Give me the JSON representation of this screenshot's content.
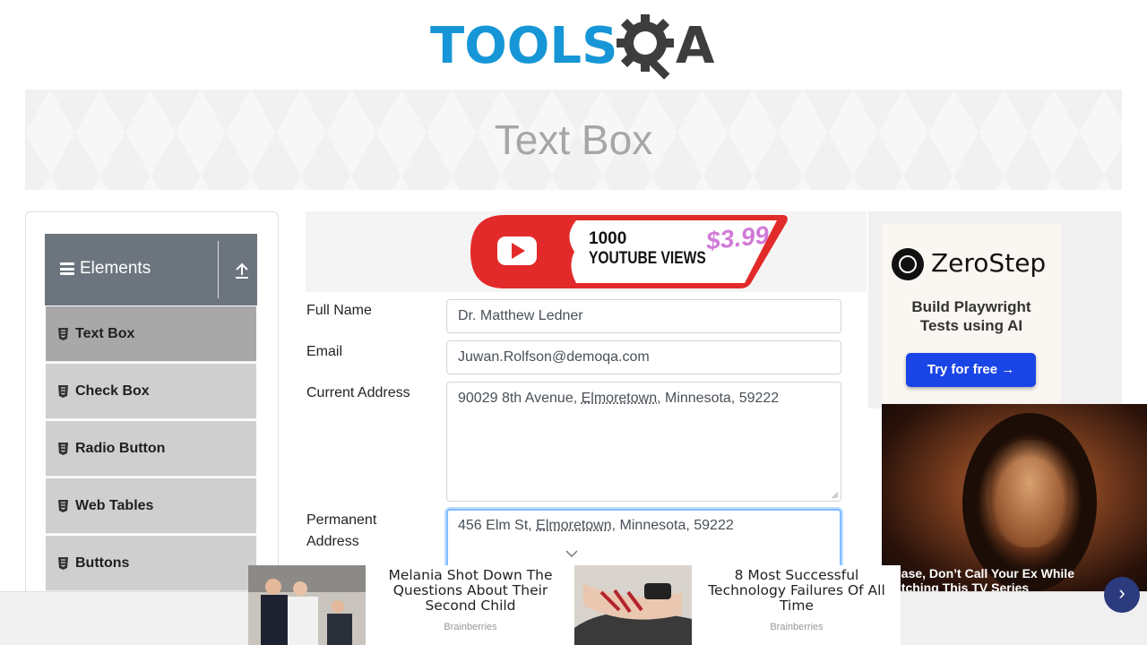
{
  "header": {
    "logo_tools": "TOOLS",
    "logo_a": "A"
  },
  "banner": {
    "title": "Text Box"
  },
  "sidebar": {
    "group_title": "Elements",
    "items": [
      {
        "label": "Text Box",
        "active": true
      },
      {
        "label": "Check Box"
      },
      {
        "label": "Radio Button"
      },
      {
        "label": "Web Tables"
      },
      {
        "label": "Buttons"
      }
    ]
  },
  "top_ad": {
    "line1": "1000",
    "line2": "YOUTUBE VIEWS",
    "price": "$3.99"
  },
  "form": {
    "full_name_label": "Full Name",
    "full_name_value": "Dr. Matthew Ledner",
    "email_label": "Email",
    "email_value": "Juwan.Rolfson@demoqa.com",
    "current_address_label": "Current Address",
    "current_address_pre": "90029 8th Avenue, ",
    "current_address_city": "Elmoretown",
    "current_address_post": ", Minnesota, 59222",
    "permanent_address_label_1": "Permanent",
    "permanent_address_label_2": "Address",
    "permanent_address_pre": "456 Elm St, ",
    "permanent_address_city": "Elmoretown",
    "permanent_address_post": ", Minnesota, 59222"
  },
  "side_ad": {
    "brand": "ZeroStep",
    "tagline_1": "Build Playwright",
    "tagline_2": "Tests using AI",
    "cta": "Try for free →"
  },
  "video_ad": {
    "title_1": "ease, Don’t Call Your Ex While",
    "title_2": "atching This TV Series",
    "next_icon": "›"
  },
  "bottom_ads": [
    {
      "headline": "Melania Shot Down The Questions About Their Second Child",
      "source": "Brainberries"
    },
    {
      "headline": "8 Most Successful Technology Failures Of All Time",
      "source": "Brainberries"
    }
  ],
  "colors": {
    "logo_blue": "#1696d6",
    "logo_dark": "#3d3d3d",
    "sidebar_header": "#6c757d",
    "menu_item": "#cfcfcf",
    "menu_active": "#a8a8a8",
    "cta_blue": "#1a45e6"
  }
}
